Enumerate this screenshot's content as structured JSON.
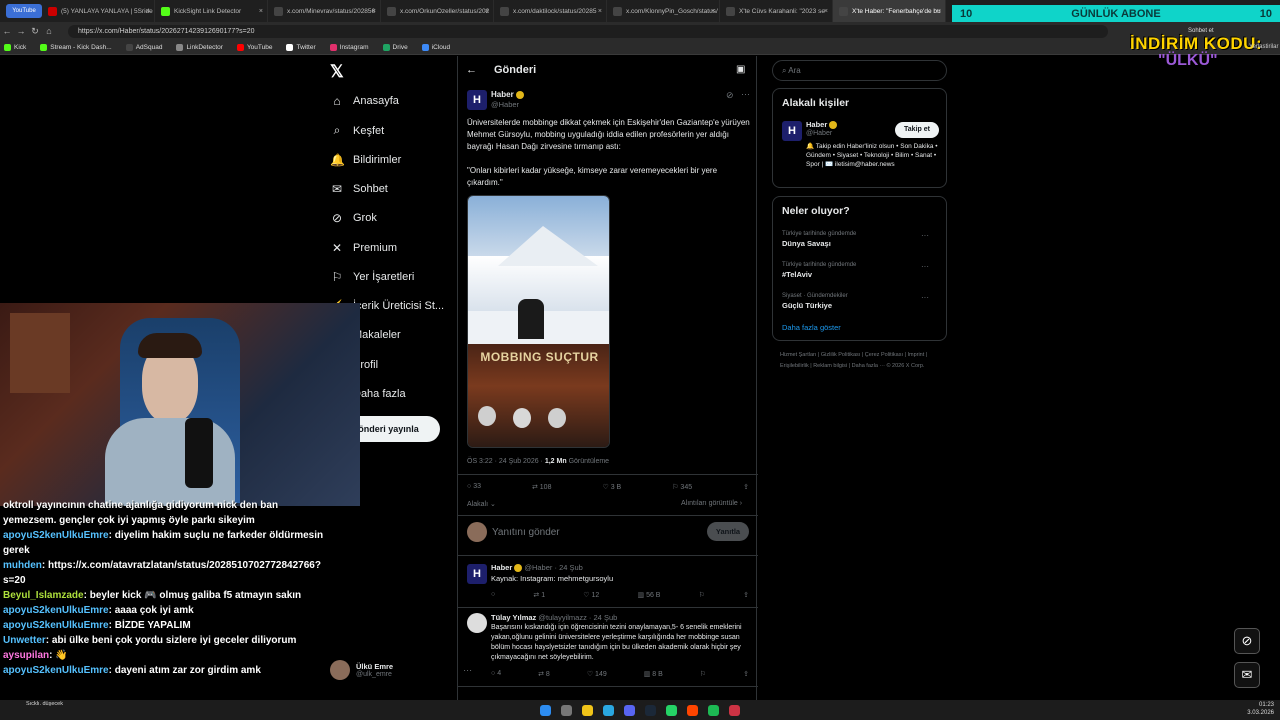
{
  "tabs": [
    {
      "label": "(5) YANLAYA YANLAYA | 5Sride",
      "fav": "#cc0000"
    },
    {
      "label": "KickSight Link Detector",
      "fav": "#53fc18"
    },
    {
      "label": "x.com/Minevrav/status/202856",
      "fav": "#444444"
    },
    {
      "label": "x.com/OrkunOzeller/status/202",
      "fav": "#444444"
    },
    {
      "label": "x.com/daktilock/status/20285",
      "fav": "#444444"
    },
    {
      "label": "x.com/KlonnyPin_Gosch/status/",
      "fav": "#444444"
    },
    {
      "label": "X'te Cüvs Karahanli: \"2023 se",
      "fav": "#444444"
    },
    {
      "label": "X'te Haber: \"Fenerbahçe'de bu",
      "fav": "#444444"
    }
  ],
  "youtube_badge": "YouTube",
  "url": "https://x.com/Haber/status/2026271423912690177?s=20",
  "bookmarks": [
    "Kick",
    "Stream - Kick Dash...",
    "AdSquad",
    "LinkDetector",
    "YouTube",
    "Twitter",
    "Instagram",
    "Drive",
    "iCloud"
  ],
  "profile_menu": {
    "top": "Sohbet et",
    "bottom": "Yerlastirilar"
  },
  "overlay": {
    "sub_left": "10",
    "sub_title": "GÜNLÜK ABONE",
    "sub_right": "10",
    "promo_title": "İNDİRİM KODU:",
    "promo_code": "\"ÜLKÜ\""
  },
  "nav": [
    {
      "label": "Anasayfa",
      "icon": "home-icon",
      "glyph": "⌂"
    },
    {
      "label": "Keşfet",
      "icon": "search-icon",
      "glyph": "⌕"
    },
    {
      "label": "Bildirimler",
      "icon": "bell-icon",
      "glyph": "🔔"
    },
    {
      "label": "Sohbet",
      "icon": "mail-icon",
      "glyph": "✉"
    },
    {
      "label": "Grok",
      "icon": "grok-icon",
      "glyph": "⊘"
    },
    {
      "label": "Premium",
      "icon": "premium-icon",
      "glyph": "✕"
    },
    {
      "label": "Yer İşaretleri",
      "icon": "bookmark-icon",
      "glyph": "⚐"
    },
    {
      "label": "İçerik Üreticisi St...",
      "icon": "creator-icon",
      "glyph": "⚡"
    },
    {
      "label": "Makaleler",
      "icon": "article-icon",
      "glyph": "▤"
    },
    {
      "label": "Profil",
      "icon": "profile-icon",
      "glyph": "☺"
    },
    {
      "label": "Daha fazla",
      "icon": "more-icon",
      "glyph": "⋯"
    }
  ],
  "post_button": "Gönderi yayınla",
  "me": {
    "name": "Ülkü Emre",
    "handle": "@ulk_emre"
  },
  "header": {
    "title": "Gönderi"
  },
  "tweet": {
    "name": "Haber",
    "handle": "@Haber",
    "text1": "Üniversitelerde mobbinge dikkat çekmek için Eskişehir'den Gaziantep'e yürüyen Mehmet Gürsoylu, mobbing uyguladığı iddia edilen profesörlerin yer aldığı bayrağı Hasan Dağı zirvesine tırmanıp astı:",
    "text2": "\"Onları kibirleri kadar yükseğe, kimseye zarar veremeyecekleri bir yere çıkardım.\"",
    "banner_text": "MOBBING SUÇTUR",
    "time": "ÖS 3:22 · 24 Şub 2026 ·",
    "views": "1,2 Mn",
    "views_label": "Görüntüleme",
    "replies": "33",
    "reposts": "108",
    "likes": "3 B",
    "bookmarks": "345",
    "related": "Alakalı",
    "quotes": "Alıntıları görüntüle"
  },
  "reply_box": {
    "placeholder": "Yanıtını gönder",
    "button": "Yanıtla"
  },
  "replies": [
    {
      "name": "Haber",
      "handle": "@Haber · 24 Şub",
      "text": "Kaynak: Instagram: mehmetgursoylu",
      "c": "",
      "r": "1",
      "l": "12",
      "v": "56 B"
    },
    {
      "name": "Tülay Yılmaz",
      "handle": "@tulayyilmazz · 24 Şub",
      "text": "Başarısını kıskandığı için öğrencisinin tezini onaylamayan,5- 6 senelik emeklerini yakan,oğlunu gelinini üniversitelere yerleştirme karşılığında her mobbinge susan bölüm hocası hayslyetsizler tanıdığım için bu ülkeden akademik olarak hiçbir şey çıkmayacağını net söyleyebilirim.",
      "c": "4",
      "r": "8",
      "l": "149",
      "v": "8 B"
    }
  ],
  "search_placeholder": "Ara",
  "who": {
    "title": "Alakalı kişiler",
    "name": "Haber",
    "handle": "@Haber",
    "follow": "Takip et",
    "bio": "🔔 Takip edin Haber'liniz olsun • Son Dakika • Gündem • Siyaset • Teknoloji • Bilim • Sanat • Spor | ✉️ iletisim@haber.news"
  },
  "trends": {
    "title": "Neler oluyor?",
    "items": [
      {
        "context": "Türkiye tarihinde gündemde",
        "name": "Dünya Savaşı"
      },
      {
        "context": "Türkiye tarihinde gündemde",
        "name": "#TelAviv"
      },
      {
        "context": "Siyaset · Gündemdekiler",
        "name": "Güçlü Türkiye"
      }
    ],
    "more": "Daha fazla göster"
  },
  "footer": "Hizmet Şartları | Gizlilik Politikası | Çerez Politikası | Imprint | Erişilebilirlik | Reklam bilgisi | Daha fazla ··· © 2026 X Corp.",
  "chat": [
    {
      "user": "",
      "msg": "oktroll yayıncının chatine ajanlığa gidiyorum nick den ban yemezsem. gençler çok iyi yapmış öyle parkı sikeyim"
    },
    {
      "user": "apoyuS2kenUlkuEmre",
      "msg": ": diyelim hakim suçlu ne farkeder öldürmesin gerek"
    },
    {
      "user": "muhden",
      "msg": ": https://x.com/atavratzlatan/status/2028510702772842766?s=20"
    },
    {
      "user": "Beyul_Islamzade",
      "msg": ": beyler kick 🎮 olmuş galiba f5 atmayın sakın"
    },
    {
      "user": "apoyuS2kenUlkuEmre",
      "msg": ": aaaa çok iyi amk"
    },
    {
      "user": "apoyuS2kenUlkuEmre",
      "msg": ": BİZDE YAPALIM"
    },
    {
      "user": "Unwetter",
      "msg": ": abi ülke beni çok yordu sizlere iyi geceler diliyorum"
    },
    {
      "user": "aysupilan",
      "msg": ": 👋"
    },
    {
      "user": "apoyuS2kenUlkuEmre",
      "msg": ": dayeni atım zar zor girdim amk"
    }
  ],
  "taskbar": {
    "time": "01:23",
    "date": "3.03.2026",
    "weather": "Sıcklı. düşecek"
  }
}
